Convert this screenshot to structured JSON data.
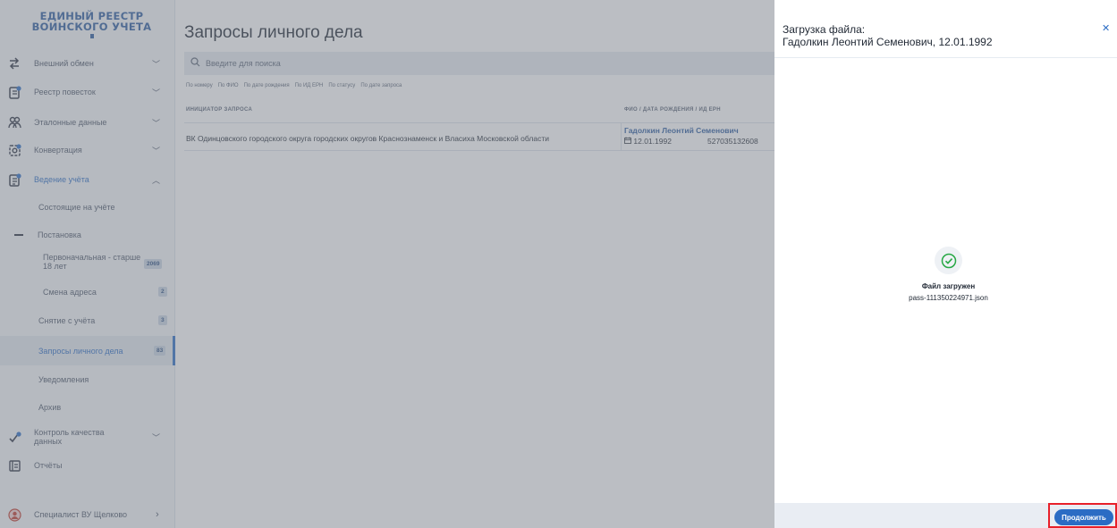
{
  "app": {
    "logo_line1": "ЕДИНЫЙ РЕЕСТР",
    "logo_line2": "ВОИНСКОГО УЧЕТА"
  },
  "sidebar": {
    "items": [
      {
        "label": "Внешний обмен",
        "icon": "exchange-arrows-icon"
      },
      {
        "label": "Реестр повесток",
        "icon": "document-badge-icon"
      },
      {
        "label": "Эталонные данные",
        "icon": "people-icon"
      },
      {
        "label": "Конвертация",
        "icon": "convert-icon"
      },
      {
        "label": "Ведение учёта",
        "icon": "records-badge-icon"
      },
      {
        "label": "Контроль качества данных",
        "icon": "quality-check-icon"
      },
      {
        "label": "Отчёты",
        "icon": "reports-icon"
      }
    ],
    "sub": {
      "registered": "Состоящие на учёте",
      "registration": "Постановка",
      "initial": "Первоначальная - старше 18 лет",
      "initial_count": "2069",
      "address_change": "Смена адреса",
      "address_count": "2",
      "deregistration": "Снятие с учёта",
      "deregistration_count": "3",
      "requests": "Запросы личного дела",
      "requests_count": "83",
      "notifications": "Уведомления",
      "archive": "Архив"
    },
    "user": "Специалист ВУ Щелково"
  },
  "main": {
    "title": "Запросы личного дела",
    "search_placeholder": "Введите для поиска",
    "filters": [
      "По номеру",
      "По ФИО",
      "По дате рождения",
      "По ИД ЕРН",
      "По статусу",
      "По дате запроса"
    ],
    "col_initiator": "ИНИЦИАТОР ЗАПРОСА",
    "col_person": "ФИО / ДАТА РОЖДЕНИЯ / ИД ЕРН",
    "row": {
      "initiator": "ВК Одинцовского городского округа городских округов Краснознаменск и Власиха Московской области",
      "fio": "Гадолкин Леонтий Семенович",
      "dob": "12.01.1992",
      "ern": "527035132608"
    }
  },
  "drawer": {
    "title_line1": "Загрузка файла:",
    "title_line2": "Гадолкин Леонтий Семенович, 12.01.1992",
    "status": "Файл загружен",
    "filename": "pass-111350224971.json",
    "continue": "Продолжить"
  },
  "colors": {
    "accent": "#2b6cc4",
    "success": "#27a844",
    "highlight": "#e8202a"
  }
}
